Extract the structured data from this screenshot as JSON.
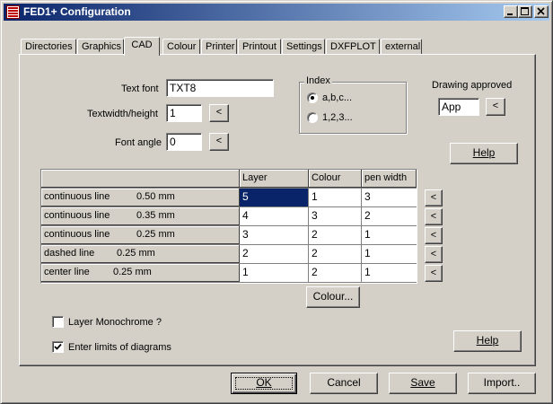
{
  "window": {
    "title": "FED1+ Configuration"
  },
  "title_buttons": {
    "minimize_icon": "minimize-icon",
    "maximize_icon": "maximize-icon",
    "close_icon": "close-icon"
  },
  "tabs": [
    "Directories",
    "Graphics",
    "CAD",
    "Colour",
    "Printer",
    "Printout",
    "Settings",
    "DXFPLOT",
    "external"
  ],
  "active_tab": "CAD",
  "text_font": {
    "label": "Text font",
    "value": "TXT8"
  },
  "textwidth": {
    "label": "Textwidth/height",
    "value": "1",
    "button": "<"
  },
  "font_angle": {
    "label": "Font angle",
    "value": "0",
    "button": "<"
  },
  "index": {
    "title": "Index",
    "options": [
      "a,b,c...",
      "1,2,3..."
    ],
    "selected": "a,b,c..."
  },
  "drawing_approved": {
    "label": "Drawing approved",
    "value": "App",
    "button": "<"
  },
  "help_top": "Help",
  "table": {
    "columns": [
      "",
      "Layer",
      "Colour",
      "pen width"
    ],
    "rows": [
      {
        "name": "continuous line",
        "width": "0.50 mm",
        "layer": "5",
        "colour": "1",
        "pen": "3"
      },
      {
        "name": "continuous line",
        "width": "0.35 mm",
        "layer": "4",
        "colour": "3",
        "pen": "2"
      },
      {
        "name": "continuous line",
        "width": "0.25 mm",
        "layer": "3",
        "colour": "2",
        "pen": "1"
      },
      {
        "name": "dashed line",
        "width": "0.25 mm",
        "layer": "2",
        "colour": "2",
        "pen": "1"
      },
      {
        "name": "center line",
        "width": "0.25 mm",
        "layer": "1",
        "colour": "2",
        "pen": "1"
      }
    ],
    "row_button": "<"
  },
  "colour_button": "Colour...",
  "layer_monochrome": {
    "label": "Layer Monochrome ?",
    "checked": false
  },
  "enter_limits": {
    "label": "Enter limits of diagrams",
    "checked": true
  },
  "help_bottom": "Help",
  "footer": {
    "ok": "OK",
    "cancel": "Cancel",
    "save": "Save",
    "import": "Import.."
  }
}
